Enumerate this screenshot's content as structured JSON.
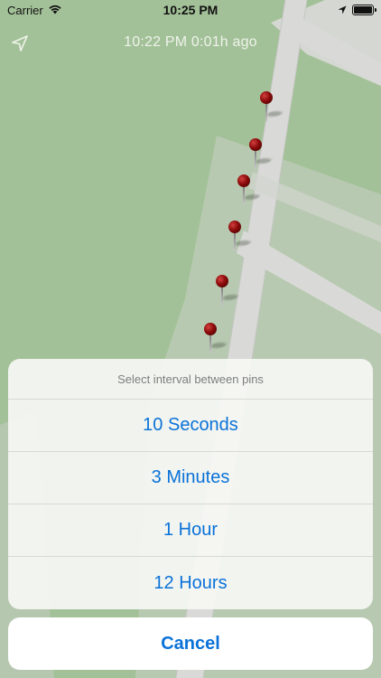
{
  "status_bar": {
    "carrier": "Carrier",
    "time": "10:25 PM"
  },
  "nav": {
    "title": "10:22 PM 0:01h ago",
    "location_icon": "location-arrow-icon"
  },
  "pins": {
    "count": 6,
    "icon": "map-pin-icon"
  },
  "action_sheet": {
    "header": "Select interval between pins",
    "options": [
      {
        "label": "10 Seconds"
      },
      {
        "label": "3 Minutes"
      },
      {
        "label": "1 Hour"
      },
      {
        "label": "12 Hours"
      }
    ],
    "cancel_label": "Cancel"
  },
  "colors": {
    "accent": "#0a72d8",
    "map_green": "#a3c198",
    "road": "#d9dad7"
  }
}
